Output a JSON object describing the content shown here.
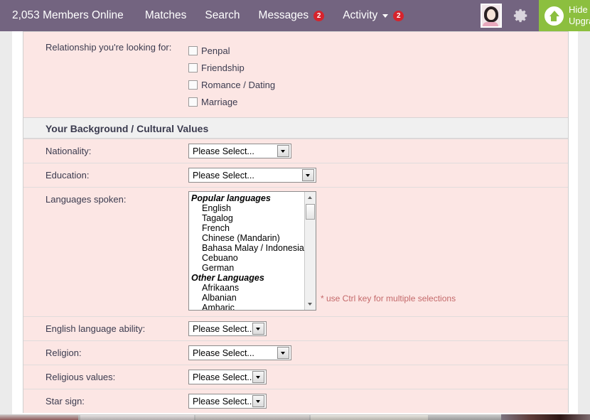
{
  "navbar": {
    "members_online": "2,053 Members Online",
    "items": [
      {
        "label": "Matches",
        "badge": null,
        "caret": false
      },
      {
        "label": "Search",
        "badge": null,
        "caret": false
      },
      {
        "label": "Messages",
        "badge": "2",
        "caret": false
      },
      {
        "label": "Activity",
        "badge": "2",
        "caret": true
      }
    ],
    "avatar_name": "user-avatar",
    "gear_name": "settings-gear-icon",
    "upgrade": {
      "line1": "Hide Yo",
      "line2": "Upgrad",
      "icon": "up-arrow-circle-icon",
      "color": "#8cbf3f"
    },
    "bar_color": "#736480",
    "badge_color": "#d6232c"
  },
  "form": {
    "relationship": {
      "label": "Relationship you're looking for:",
      "options": [
        {
          "label": "Penpal",
          "checked": false
        },
        {
          "label": "Friendship",
          "checked": false
        },
        {
          "label": "Romance / Dating",
          "checked": false
        },
        {
          "label": "Marriage",
          "checked": false
        }
      ]
    },
    "section_title": "Your Background / Cultural Values",
    "placeholder_select": "Please Select...",
    "rows": [
      {
        "label": "Nationality:",
        "value": "Please Select...",
        "width": "w-mid"
      },
      {
        "label": "Education:",
        "value": "Please Select...",
        "width": "w-wide"
      }
    ],
    "languages": {
      "label": "Languages spoken:",
      "hint": "* use Ctrl key for multiple selections",
      "groups": [
        {
          "name": "Popular languages",
          "options": [
            "English",
            "Tagalog",
            "French",
            "Chinese (Mandarin)",
            "Bahasa Malay / Indonesian",
            "Cebuano",
            "German"
          ]
        },
        {
          "name": "Other Languages",
          "options": [
            "Afrikaans",
            "Albanian",
            "Amharic"
          ]
        }
      ]
    },
    "rows2": [
      {
        "label": "English language ability:",
        "value": "Please Select...",
        "width": "w-narrow"
      },
      {
        "label": "Religion:",
        "value": "Please Select...",
        "width": "w-mid"
      },
      {
        "label": "Religious values:",
        "value": "Please Select...",
        "width": "w-narrow"
      },
      {
        "label": "Star sign:",
        "value": "Please Select...",
        "width": "w-narrow"
      }
    ]
  }
}
